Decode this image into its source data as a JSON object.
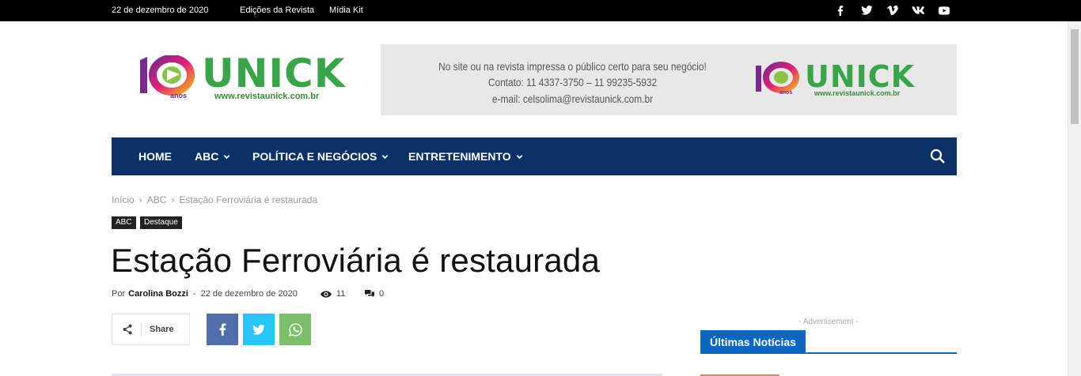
{
  "topbar": {
    "date": "22 de dezembro de 2020",
    "links": [
      "Edições da Revista",
      "Mídia Kit"
    ],
    "social_icons": [
      "facebook-icon",
      "twitter-icon",
      "vimeo-icon",
      "vk-icon",
      "youtube-icon"
    ]
  },
  "logo": {
    "number": "10",
    "brand": "UNICK",
    "anos": "anos",
    "url": "www.revistaunick.com.br"
  },
  "banner": {
    "line1": "No site ou na revista impressa o público certo para seu negócio!",
    "line2": "Contato: 11 4337-3750 – 11 99235-5932",
    "line3": "e-mail: celsolima@revistaunick.com.br"
  },
  "nav": {
    "items": [
      {
        "label": "HOME",
        "dropdown": false
      },
      {
        "label": "ABC",
        "dropdown": true
      },
      {
        "label": "POLÍTICA E NEGÓCIOS",
        "dropdown": true
      },
      {
        "label": "ENTRETENIMENTO",
        "dropdown": true
      }
    ]
  },
  "breadcrumb": [
    "Início",
    "ABC",
    "Estação Ferroviária é restaurada"
  ],
  "tags": [
    "ABC",
    "Destaque"
  ],
  "article": {
    "title": "Estação Ferroviária é restaurada",
    "by_label": "Por",
    "author": "Carolina Bozzi",
    "date": "22 de dezembro de 2020",
    "views": "11",
    "comments": "0"
  },
  "share": {
    "label": "Share",
    "buttons": [
      "facebook-icon",
      "twitter-icon",
      "whatsapp-icon"
    ]
  },
  "sidebar": {
    "advertisement": "- Advertisement -",
    "widget_title": "Últimas Notícias"
  },
  "colors": {
    "nav_bg": "#0b3168",
    "widget_blue": "#0b67c1",
    "facebook": "#516eab",
    "twitter": "#29c5f6",
    "whatsapp": "#7bbf6a",
    "logo_green": "#3aa44a",
    "logo_purple": "#7a2a8c"
  }
}
